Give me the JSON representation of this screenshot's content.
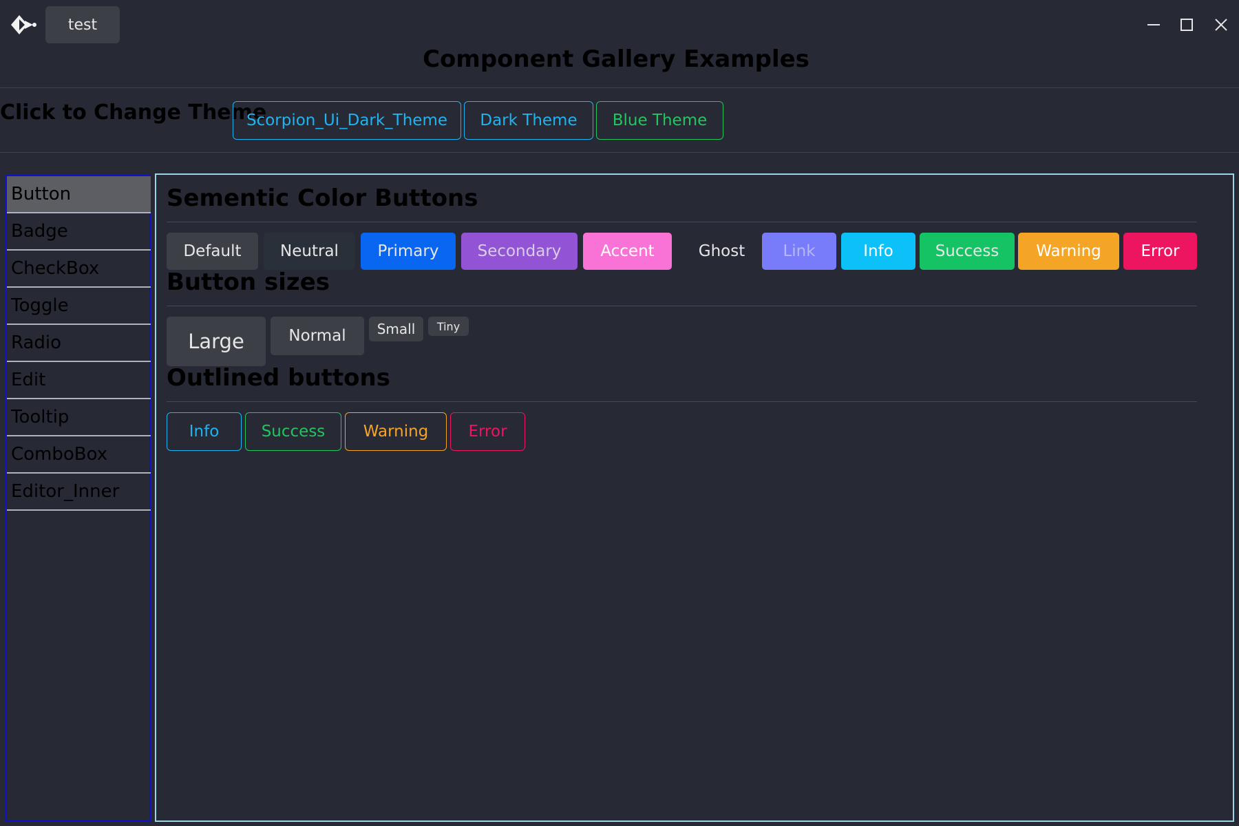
{
  "titlebar": {
    "tab_label": "test",
    "window_title": "Component Gallery Examples"
  },
  "themebar": {
    "label": "Click to Change Theme",
    "buttons": [
      {
        "label": "Scorpion_Ui_Dark_Theme",
        "color": "#1eb4f0"
      },
      {
        "label": "Dark Theme",
        "color": "#1eb4f0"
      },
      {
        "label": "Blue Theme",
        "color": "#22c55e"
      }
    ]
  },
  "sidebar": {
    "items": [
      {
        "label": "Button",
        "active": true
      },
      {
        "label": "Badge"
      },
      {
        "label": "CheckBox"
      },
      {
        "label": "Toggle"
      },
      {
        "label": "Radio"
      },
      {
        "label": "Edit"
      },
      {
        "label": "Tooltip"
      },
      {
        "label": "ComboBox"
      },
      {
        "label": "Editor_Inner"
      }
    ]
  },
  "sections": {
    "semantic_title": "Sementic Color Buttons",
    "sizes_title": "Button sizes",
    "outlined_title": "Outlined buttons"
  },
  "semantic_buttons": [
    {
      "label": "Default",
      "bg": "#3d3f47",
      "fg": "#e6e6e6"
    },
    {
      "label": "Neutral",
      "bg": "#2a303a",
      "fg": "#e6e6e6"
    },
    {
      "label": "Primary",
      "bg": "#0866f0",
      "fg": "#e6e6e6"
    },
    {
      "label": "Secondary",
      "bg": "#9254d4",
      "fg": "#d8cce6"
    },
    {
      "label": "Accent",
      "bg": "#f973d6",
      "fg": "#ffffff"
    },
    {
      "label": "Ghost",
      "bg": "transparent",
      "fg": "#e6e6e6"
    },
    {
      "label": "Link",
      "bg": "#787cfa",
      "fg": "#b6b9f5"
    },
    {
      "label": "Info",
      "bg": "#0cc0f8",
      "fg": "#ffffff"
    },
    {
      "label": "Success",
      "bg": "#15c364",
      "fg": "#e6e6e6"
    },
    {
      "label": "Warning",
      "bg": "#f5a526",
      "fg": "#ffffff"
    },
    {
      "label": "Error",
      "bg": "#ee1560",
      "fg": "#ffffff"
    }
  ],
  "size_buttons": {
    "large": "Large",
    "normal": "Normal",
    "small": "Small",
    "tiny": "Tiny"
  },
  "outlined_buttons": [
    {
      "label": "Info",
      "color": "#1eb4f0"
    },
    {
      "label": "Success",
      "color": "#22c55e"
    },
    {
      "label": "Warning",
      "color": "#f5a526"
    },
    {
      "label": "Error",
      "color": "#ee1560"
    }
  ],
  "icons": [
    "app-logo-icon",
    "minimize-icon",
    "maximize-icon",
    "close-icon"
  ]
}
